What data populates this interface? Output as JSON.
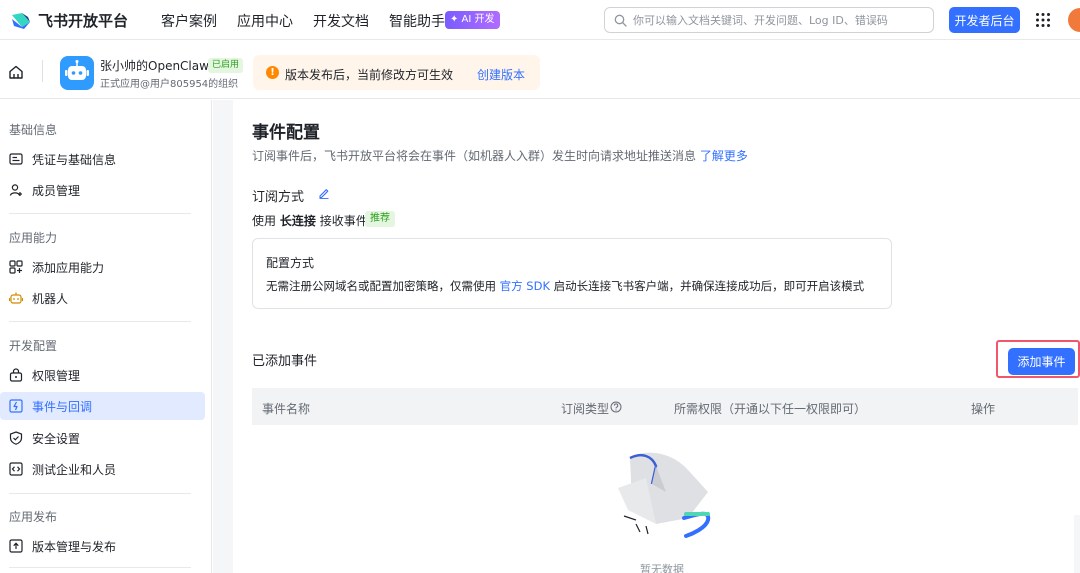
{
  "header": {
    "brand": "飞书开放平台",
    "nav": [
      "客户案例",
      "应用中心",
      "开发文档",
      "智能助手"
    ],
    "ai_badge": "✦ AI 开发",
    "search_placeholder": "你可以输入文档关键词、开发问题、Log ID、错误码",
    "dev_console_label": "开发者后台",
    "colors": {
      "primary": "#3370ff",
      "avatar": "#f07a3b"
    }
  },
  "appbar": {
    "app_name": "张小帅的OpenClaw",
    "status_tag": "已启用",
    "org": "正式应用@用户805954的组织",
    "notice_text": "版本发布后，当前修改方可生效",
    "notice_link": "创建版本"
  },
  "sidebar": {
    "groups": [
      {
        "title": "基础信息",
        "items": [
          "凭证与基础信息",
          "成员管理"
        ]
      },
      {
        "title": "应用能力",
        "items": [
          "添加应用能力",
          "机器人"
        ]
      },
      {
        "title": "开发配置",
        "items": [
          "权限管理",
          "事件与回调",
          "安全设置",
          "测试企业和人员"
        ]
      },
      {
        "title": "应用发布",
        "items": [
          "版本管理与发布"
        ]
      }
    ],
    "active_item": "事件与回调"
  },
  "main": {
    "title": "事件配置",
    "description": "订阅事件后，飞书开放平台将会在事件（如机器人入群）发生时向请求地址推送消息",
    "learn_more": "了解更多",
    "subscribe_title": "订阅方式",
    "mode_prefix": "使用",
    "mode_value": "长连接",
    "mode_suffix": "接收事件",
    "recommend_tag": "推荐",
    "config": {
      "title": "配置方式",
      "desc_prefix": "无需注册公网域名或配置加密策略，仅需使用",
      "desc_link": "官方 SDK",
      "desc_suffix": "启动长连接飞书客户端，并确保连接成功后，即可开启该模式"
    },
    "added_title": "已添加事件",
    "add_button": "添加事件",
    "table_headers": [
      "事件名称",
      "订阅类型",
      "所需权限（开通以下任一权限即可）",
      "操作"
    ],
    "empty_text": "暂无数据"
  }
}
